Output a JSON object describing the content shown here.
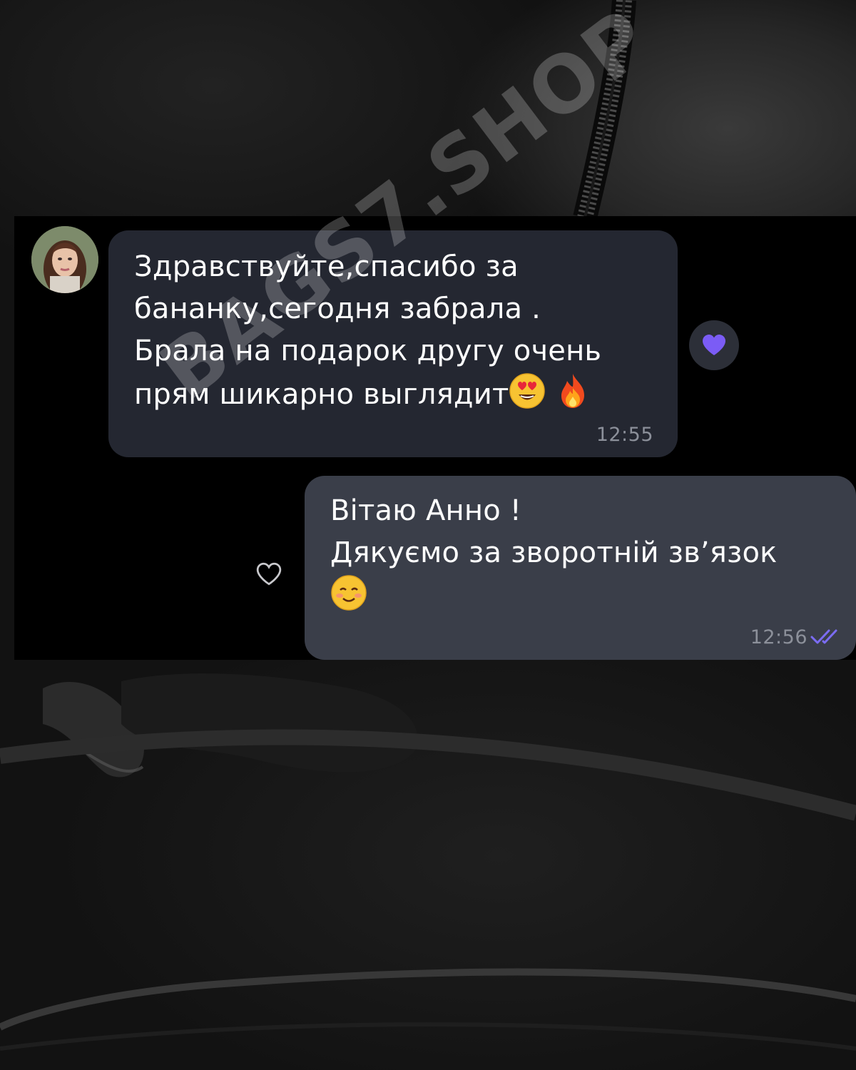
{
  "messages": [
    {
      "direction": "incoming",
      "lines": [
        "Здравствуйте,спасибо за",
        "бананку,сегодня забрала .",
        "Брала на подарок другу очень",
        "прям шикарно выглядит"
      ],
      "emojis": [
        "smiling-face-with-heart-eyes",
        "fire"
      ],
      "time": "12:55",
      "reaction": "purple-heart",
      "reaction_color": "#7b5cf5"
    },
    {
      "direction": "outgoing",
      "lines": [
        "Вітаю Анно !",
        "Дякуємо за зворотній зв’язок"
      ],
      "emojis": [
        "smiling-face"
      ],
      "time": "12:56",
      "status": "read",
      "tick_color": "#7b6cf2",
      "reaction": "heart-outline"
    }
  ],
  "watermark": "BAGS7.SHOP"
}
